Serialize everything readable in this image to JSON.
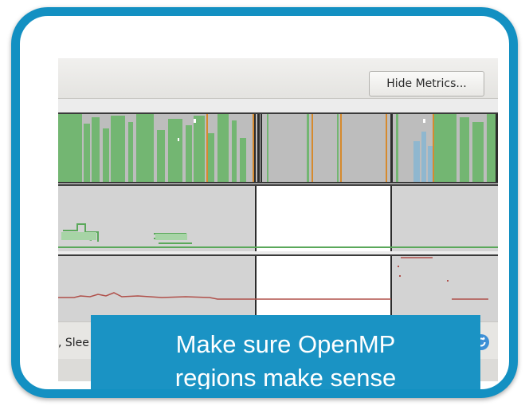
{
  "toolbar": {
    "hide_metrics_label": "Hide Metrics..."
  },
  "status": {
    "text": ", Slee"
  },
  "caption": {
    "text": "Make sure OpenMP\nregions make sense"
  },
  "colors": {
    "frame": "#1390c2",
    "caption_bg": "#1a93c4",
    "timeline_green": "#73b672",
    "timeline_gray": "#949494",
    "timeline_blue": "#8fb7cf",
    "accent_orange": "#d68a2e",
    "graph_green": "#5aa85a",
    "graph_red": "#b0504a"
  },
  "icons": {
    "refresh": "refresh-icon"
  }
}
